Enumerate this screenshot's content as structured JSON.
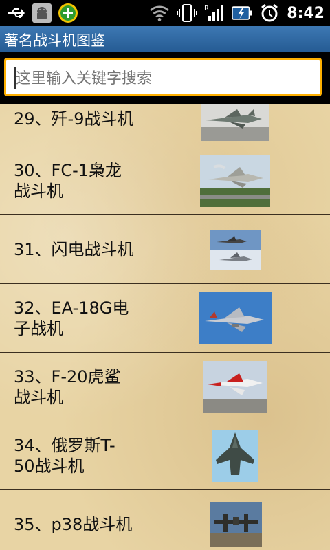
{
  "status_bar": {
    "time": "8:42",
    "left_icons": [
      "usb-icon",
      "android-icon",
      "add-green-icon"
    ],
    "right_icons": [
      "wifi-icon",
      "vibrate-icon",
      "signal-icon",
      "battery-charging-icon",
      "alarm-icon"
    ]
  },
  "app": {
    "title": "著名战斗机图鉴"
  },
  "search": {
    "placeholder": "这里输入关键字搜索",
    "value": ""
  },
  "colors": {
    "title_bar": "#2f6aa4",
    "search_border": "#ffb000",
    "list_background": "#e8d4a4"
  },
  "list": [
    {
      "label": "29、歼-9战斗机",
      "thumb": "gray-fighter-photo"
    },
    {
      "label": "30、FC-1枭龙战斗机",
      "thumb": "fighter-takeoff-photo"
    },
    {
      "label": "31、闪电战斗机",
      "thumb": "two-jets-photo"
    },
    {
      "label": "32、EA-18G电子战机",
      "thumb": "blue-sky-jet-photo"
    },
    {
      "label": "33、F-20虎鲨战斗机",
      "thumb": "red-white-jet-photo"
    },
    {
      "label": "34、俄罗斯T-50战斗机",
      "thumb": "stealth-jet-photo"
    },
    {
      "label": "35、p38战斗机",
      "thumb": "p38-photo"
    }
  ]
}
